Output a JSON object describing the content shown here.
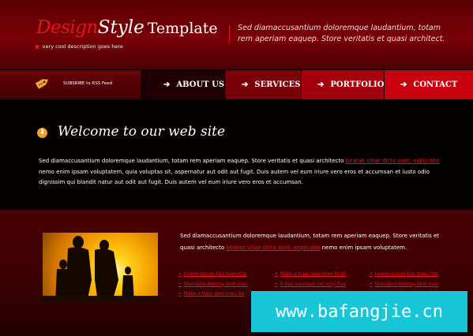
{
  "header": {
    "logo_design": "Design",
    "logo_style": "Style",
    "logo_template": "Template",
    "tagline": "very cool description goes here",
    "description": "Sed diamaccusantium doloremque laudantium, totam rem aperiam eaquep. Store veritatis et quasi architect."
  },
  "nav": {
    "rss_label": "SUBSRIBE to RSS Feed",
    "items": [
      "ABOUT US",
      "SERVICES",
      "PORTFOLIO",
      "CONTACT"
    ]
  },
  "welcome": {
    "title": "Welcome to our web site",
    "text_part1": "Sed diamaccusantium doloremque laudantium, totam rem aperiam eaquep. Store veritatis et quasi architecto ",
    "link": "beatae vitae dicta sunt, explicabo",
    "text_part2": " nemo enim ipsam voluptatem, quia voluptas sit, aspernatur aut odit aut fugit. Duis autem vel eum iriure vero eros et accumsan et iusto odio dignissim qui blandit natur aut odit aut fugit. Duis autem vel eum iriure vero eros et accumsan."
  },
  "content": {
    "text_part1": "Sed diamaccusantium doloremque laudantium, totam rem aperiam eaquep. Store veritatis et quasi architecto ",
    "link": "beatae vitae dicta sunt, explicabo",
    "text_part2": " nemo enim ipsam voluptatem.",
    "links_col1": [
      "Lorem Ipsum has been the",
      "Standard dummy text ever",
      "Make a type specimen bo"
    ],
    "links_col2": [
      "Make a type specimen book",
      "It has survived not only five",
      ""
    ],
    "links_col3": [
      "Lorem Ipsum has been the",
      "Standard dummy text ever",
      ""
    ]
  },
  "watermark": "www.bafangjie.cn",
  "colors": {
    "accent": "#e3141c",
    "header_bg": "#7a0008",
    "body_bg": "#050000"
  }
}
